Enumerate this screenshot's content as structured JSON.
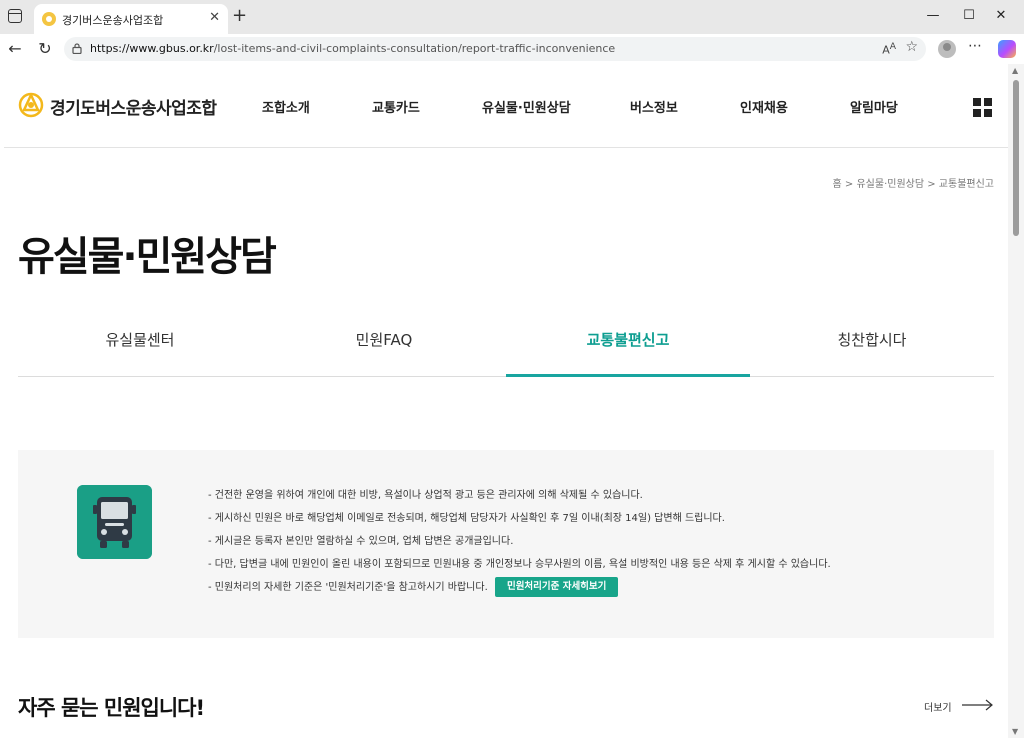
{
  "browser": {
    "tab_title": "경기버스운송사업조합",
    "url_domain": "https://www.gbus.or.kr",
    "url_path": "/lost-items-and-civil-complaints-consultation/report-traffic-inconvenience"
  },
  "header": {
    "logo_text": "경기도버스운송사업조합",
    "nav": [
      "조합소개",
      "교통카드",
      "유실물·민원상담",
      "버스정보",
      "인재채용",
      "알림마당"
    ]
  },
  "breadcrumb": "홈 > 유실물·민원상담 > 교통불편신고",
  "page_title": "유실물·민원상담",
  "sub_tabs": [
    "유실물센터",
    "민원FAQ",
    "교통불편신고",
    "칭찬합시다"
  ],
  "active_tab": "교통불편신고",
  "notice": {
    "items": [
      "- 건전한 운영을 위하여 개인에 대한 비방, 욕설이나 상업적 광고 등은 관리자에 의해 삭제될 수 있습니다.",
      "- 게시하신 민원은 바로 해당업체 이메일로 전송되며, 해당업체 담당자가 사실확인 후 7일 이내(최장 14일) 답변해 드립니다.",
      "- 게시글은 등록자 본인만 열람하실 수 있으며, 업체 답변은 공개글입니다.",
      "- 다만, 답변글 내에 민원인이 올린 내용이 포함되므로 민원내용 중 개인정보나 승무사원의 이름, 욕설 비방적인 내용 등은 삭제 후 게시할 수 있습니다.",
      "- 민원처리의 자세한 기준은 '민원처리기준'을 참고하시기 바랍니다."
    ],
    "button_label": "민원처리기준 자세히보기"
  },
  "faq": {
    "title": "자주 묻는 민원입니다!",
    "more_label": "더보기"
  },
  "colors": {
    "accent": "#18a5a0",
    "active_tab_text": "#0e9e91",
    "button": "#18a58a",
    "bus_icon_bg": "#1a9f86",
    "notice_bg": "#f6f6f6"
  }
}
